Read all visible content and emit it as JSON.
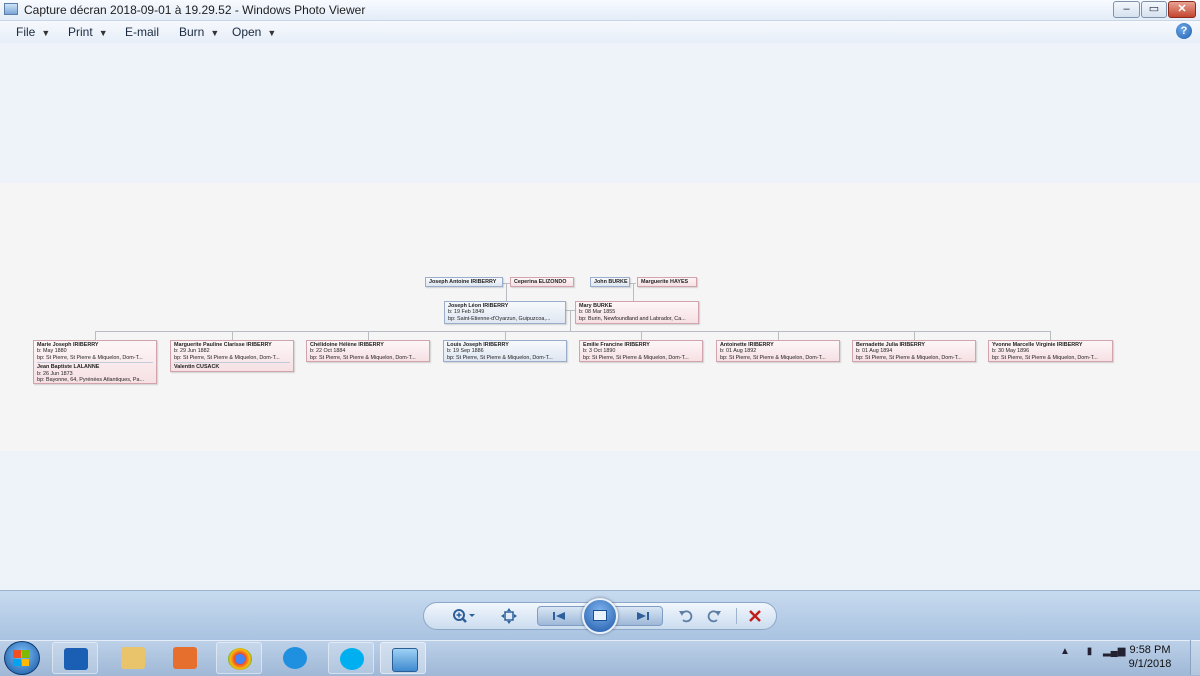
{
  "window": {
    "title": "Capture décran 2018-09-01 à 19.29.52 - Windows Photo Viewer",
    "controls": {
      "minimize": "–",
      "maximize": "▭",
      "close": "✕"
    }
  },
  "menu": [
    {
      "label": "File",
      "dropdown": true
    },
    {
      "label": "Print",
      "dropdown": true
    },
    {
      "label": "E-mail",
      "dropdown": false
    },
    {
      "label": "Burn",
      "dropdown": true
    },
    {
      "label": "Open",
      "dropdown": true
    }
  ],
  "help": "?",
  "tree": {
    "grandparents": [
      {
        "name": "Joseph Antoine IRIBERRY",
        "sex": "male"
      },
      {
        "name": "Ceperina ELIZONDO",
        "sex": "female"
      },
      {
        "name": "John BURKE",
        "sex": "male"
      },
      {
        "name": "Marguerite HAYES",
        "sex": "female"
      }
    ],
    "parents": [
      {
        "name": "Joseph Léon IRIBERRY",
        "sex": "male",
        "b": "b: 19 Feb 1849",
        "bp": "bp: Saint-Etienne-d'Oyarzun, Guipuzcoa,..."
      },
      {
        "name": "Mary BURKE",
        "sex": "female",
        "b": "b: 08 Mar 1855",
        "bp": "bp: Burin, Newfoundland and Labrador, Ca..."
      }
    ],
    "children": [
      {
        "name": "Marie Joseph IRIBERRY",
        "sex": "female",
        "b": "b: May 1880",
        "bp": "bp: St Pierre, St Pierre & Miquelon, Dom-T...",
        "spouse": {
          "name": "Jean Baptiste LALANNE",
          "b": "b: 26 Jun 1873",
          "bp": "bp: Bayonne, 64, Pyrénées Atlantiques, Pa..."
        }
      },
      {
        "name": "Marguerite Pauline Clarisse IRIBERRY",
        "sex": "female",
        "b": "b: 29 Jun 1882",
        "bp": "bp: St Pierre, St Pierre & Miquelon, Dom-T...",
        "spouse": {
          "name": "Valentin CUSACK",
          "b": "",
          "bp": ""
        }
      },
      {
        "name": "Chélidoine Hélène IRIBERRY",
        "sex": "female",
        "b": "b: 22 Oct 1884",
        "bp": "bp: St Pierre, St Pierre & Miquelon, Dom-T..."
      },
      {
        "name": "Louis Joseph IRIBERRY",
        "sex": "male",
        "b": "b: 19 Sep 1886",
        "bp": "bp: St Pierre, St Pierre & Miquelon, Dom-T..."
      },
      {
        "name": "Emilie Francine IRIBERRY",
        "sex": "female",
        "b": "b: 3 Oct 1890",
        "bp": "bp: St Pierre, St Pierre & Miquelon, Dom-T..."
      },
      {
        "name": "Antoinette IRIBERRY",
        "sex": "female",
        "b": "b: 01 Aug 1892",
        "bp": "bp: St Pierre, St Pierre & Miquelon, Dom-T..."
      },
      {
        "name": "Bernadette Julia IRIBERRY",
        "sex": "female",
        "b": "b: 01 Aug 1894",
        "bp": "bp: St Pierre, St Pierre & Miquelon, Dom-T..."
      },
      {
        "name": "Yvonne Marcelle Virginie IRIBERRY",
        "sex": "female",
        "b": "b: 30 May 1896",
        "bp": "bp: St Pierre, St Pierre & Miquelon, Dom-T..."
      }
    ]
  },
  "controls": {
    "zoom": "zoom-icon",
    "fit": "actual-size-icon",
    "previous": "previous-icon",
    "slideshow": "slideshow-icon",
    "next": "next-icon",
    "rotate_ccw": "rotate-counterclockwise-icon",
    "rotate_cw": "rotate-clockwise-icon",
    "delete": "delete-icon"
  },
  "taskbar": {
    "apps": [
      "outlook-icon",
      "file-explorer-icon",
      "media-player-icon",
      "chrome-icon",
      "internet-explorer-icon",
      "skype-icon",
      "photo-viewer-icon"
    ],
    "tray": "▲",
    "time": "9:58 PM",
    "date": "9/1/2018"
  }
}
